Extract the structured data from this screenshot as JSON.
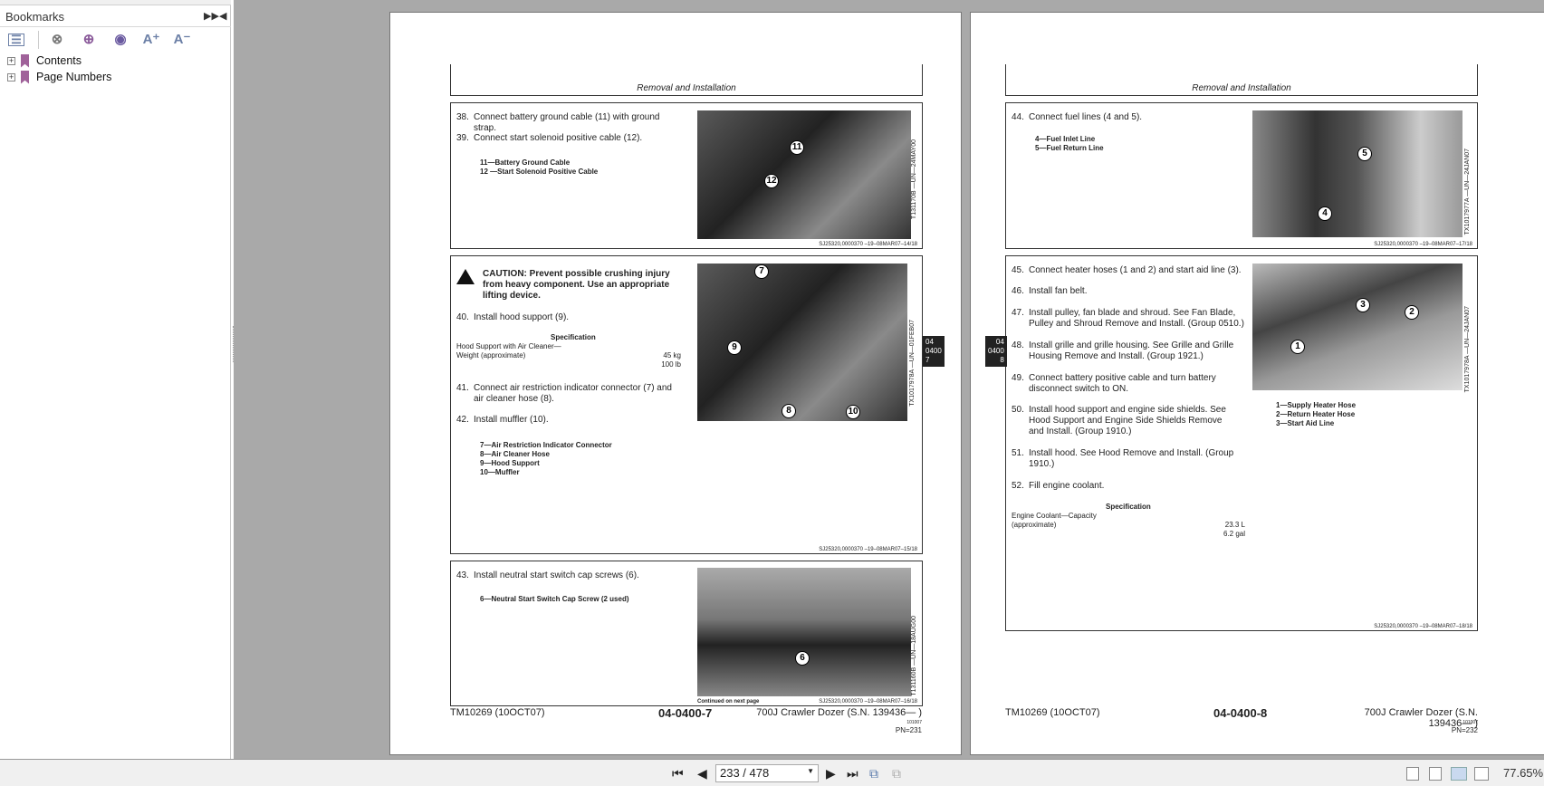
{
  "sidebar": {
    "title": "Bookmarks",
    "collapse_icons": [
      "expand-all-icon",
      "collapse-panel-icon"
    ],
    "tools": [
      "options-icon",
      "delete-bookmark-icon",
      "add-bookmark-icon",
      "goto-bookmark-icon",
      "increase-font-icon",
      "decrease-font-icon"
    ],
    "items": [
      {
        "label": "Contents"
      },
      {
        "label": "Page Numbers"
      }
    ]
  },
  "left_page": {
    "header": "Removal and Installation",
    "boxes": [
      {
        "steps": [
          {
            "n": "38.",
            "t": "Connect battery ground cable (11) with ground strap."
          },
          {
            "n": "39.",
            "t": "Connect start solenoid positive cable (12)."
          }
        ],
        "legend": [
          "11—Battery Ground Cable",
          "12 —Start Solenoid Positive Cable"
        ],
        "photo_id": "T131170B  —UN—24MAY00",
        "callouts": [
          "11",
          "12"
        ],
        "ref": "SJ25320,0000370  –19–08MAR07–14/18"
      },
      {
        "caution": "CAUTION: Prevent possible crushing injury from heavy component. Use an appropriate lifting device.",
        "steps": [
          {
            "n": "40.",
            "t": "Install hood support (9)."
          },
          {
            "n": "41.",
            "t": "Connect air restriction indicator connector (7) and air cleaner hose (8)."
          },
          {
            "n": "42.",
            "t": "Install muffler (10)."
          }
        ],
        "spec": {
          "heading": "Specification",
          "label1": "Hood Support with Air Cleaner—",
          "label2": "Weight (approximate)",
          "value1": "45 kg",
          "value2": "100 lb"
        },
        "legend": [
          "7—Air Restriction Indicator Connector",
          "8—Air Cleaner Hose",
          "9—Hood Support",
          "10—Muffler"
        ],
        "photo_id": "TX1017978A  —UN—01FEB07",
        "callouts": [
          "7",
          "9",
          "8",
          "10"
        ],
        "ref": "SJ25320,0000370  –19–08MAR07–15/18"
      },
      {
        "steps": [
          {
            "n": "43.",
            "t": "Install neutral start switch cap screws (6)."
          }
        ],
        "legend": [
          "6—Neutral Start Switch Cap Screw (2 used)"
        ],
        "photo_id": "T131160B  —UN—18AUG00",
        "callouts": [
          "6"
        ],
        "continued": "Continued on next page",
        "ref": "SJ25320,0000370  –19–08MAR07–16/18"
      }
    ],
    "tab": [
      "04",
      "0400",
      "7"
    ],
    "footer": {
      "manual": "TM10269 (10OCT07)",
      "page": "04-0400-7",
      "model": "700J Crawler Dozer (S.N. 139436— )",
      "code": "101007",
      "pn": "PN=231"
    }
  },
  "right_page": {
    "header": "Removal and Installation",
    "boxes": [
      {
        "steps": [
          {
            "n": "44.",
            "t": "Connect fuel lines (4 and 5)."
          }
        ],
        "legend": [
          "4—Fuel Inlet Line",
          "5—Fuel Return Line"
        ],
        "photo_id": "TX1017977A  —UN—24JAN07",
        "callouts": [
          "5",
          "4"
        ],
        "ref": "SJ25320,0000370  –19–08MAR07–17/18"
      },
      {
        "steps": [
          {
            "n": "45.",
            "t": "Connect heater hoses (1 and 2) and start aid line (3)."
          },
          {
            "n": "46.",
            "t": "Install fan belt."
          },
          {
            "n": "47.",
            "t": "Install pulley, fan blade and shroud. See Fan Blade, Pulley and Shroud Remove and Install. (Group 0510.)"
          },
          {
            "n": "48.",
            "t": "Install grille and grille housing. See Grille and Grille Housing Remove and Install. (Group 1921.)"
          },
          {
            "n": "49.",
            "t": "Connect battery positive cable and turn battery disconnect switch to ON."
          },
          {
            "n": "50.",
            "t": "Install hood support and engine side shields. See Hood Support and Engine Side Shields Remove and Install. (Group 1910.)"
          },
          {
            "n": "51.",
            "t": "Install hood. See Hood Remove and Install. (Group 1910.)"
          },
          {
            "n": "52.",
            "t": "Fill engine coolant."
          }
        ],
        "spec": {
          "heading": "Specification",
          "label1": "Engine Coolant—Capacity",
          "label2": "(approximate)",
          "value1": "23.3 L",
          "value2": "6.2 gal"
        },
        "legend": [
          "1—Supply Heater Hose",
          "2—Return Heater Hose",
          "3—Start Aid Line"
        ],
        "photo_id": "TX1017978A  —UN—24JAN07",
        "callouts": [
          "3",
          "2",
          "1"
        ],
        "ref": "SJ25320,0000370  –19–08MAR07–18/18"
      }
    ],
    "tab": [
      "04",
      "0400",
      "8"
    ],
    "footer": {
      "manual": "TM10269 (10OCT07)",
      "page": "04-0400-8",
      "model": "700J Crawler Dozer (S.N. 139436— )",
      "code": "101007",
      "pn": "PN=232"
    }
  },
  "bottom": {
    "page_value": "233 / 478",
    "zoom": "77.65%",
    "view_modes": [
      "single-page",
      "continuous",
      "facing",
      "continuous-facing"
    ],
    "active_view": "facing"
  }
}
